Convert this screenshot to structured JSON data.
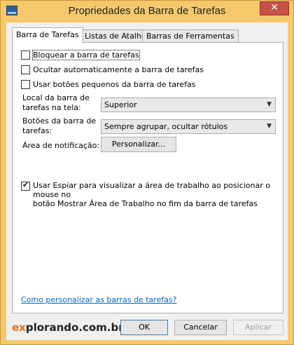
{
  "window": {
    "title": "Propriedades da Barra de Tarefas",
    "close_glyph": "✕"
  },
  "tabs": [
    {
      "label": "Barra de Tarefas",
      "active": true
    },
    {
      "label": "Listas de Atalhos",
      "active": false
    },
    {
      "label": "Barras de Ferramentas",
      "active": false
    }
  ],
  "options": {
    "lock_taskbar": {
      "label": "Bloquear a barra de tarefas",
      "checked": false
    },
    "auto_hide": {
      "label": "Ocultar automaticamente a barra de tarefas",
      "checked": false
    },
    "small_buttons": {
      "label": "Usar botões pequenos da barra de tarefas",
      "checked": false
    }
  },
  "location": {
    "label_line1": "Local da barra de",
    "label_line2": "tarefas na tela:",
    "value": "Superior"
  },
  "buttons_group": {
    "label_line1": "Botões da barra de",
    "label_line2": "tarefas:",
    "value": "Sempre agrupar, ocultar rótulos"
  },
  "notification": {
    "label": "Área de notificação:",
    "button": "Personalizar..."
  },
  "peek": {
    "line1": "Usar Espiar para visualizar a área de trabalho ao posicionar o mouse no",
    "line2": "botão Mostrar Área de Trabalho no fim da barra de tarefas",
    "checked": true
  },
  "help_link": "Como personalizar as barras de tarefas?",
  "brand": {
    "accent": "ex",
    "rest": "plorando.com.br",
    "accent_color": "#e0721c"
  },
  "footer": {
    "ok": "OK",
    "cancel": "Cancelar",
    "apply": "Aplicar"
  },
  "colors": {
    "frame": "#f5c96b",
    "close": "#c7504a",
    "link": "#0066cc"
  },
  "icons": {
    "title": "taskbar-properties-icon",
    "dropdown": "chevron-down-icon"
  }
}
